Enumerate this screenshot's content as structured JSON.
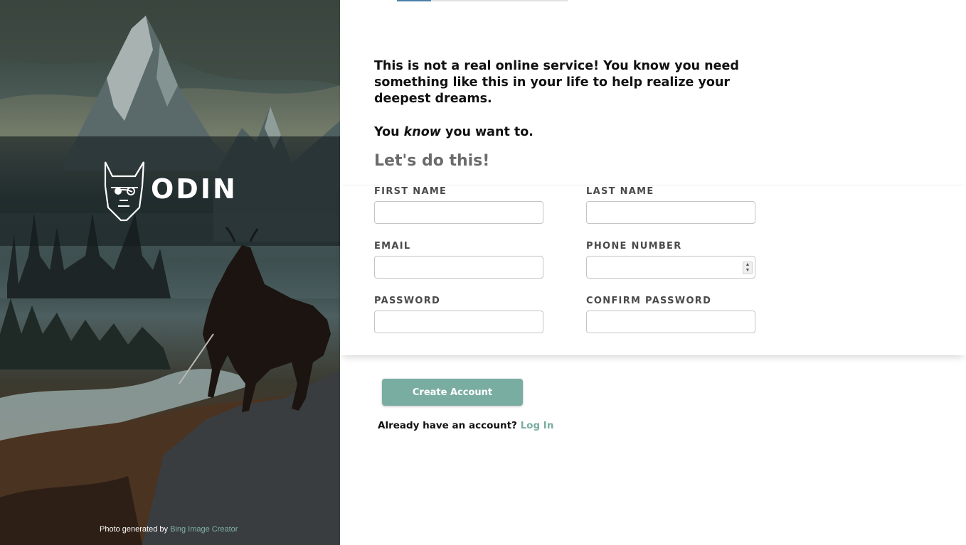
{
  "brand": {
    "name": "ODIN",
    "logo_icon": "viking-helmet-icon"
  },
  "hero": {
    "credit_prefix": "Photo generated by ",
    "credit_link": "Bing Image Creator"
  },
  "intro": {
    "line1": "This is not a real online service! You know you need something like this in your life to help realize your deepest dreams.",
    "line2_pre": "You ",
    "line2_em": "know",
    "line2_post": " you want to."
  },
  "form": {
    "heading": "Let's do this!",
    "fields": {
      "first_name": {
        "label": "FIRST NAME",
        "value": ""
      },
      "last_name": {
        "label": "LAST NAME",
        "value": ""
      },
      "email": {
        "label": "EMAIL",
        "value": ""
      },
      "phone": {
        "label": "PHONE NUMBER",
        "value": ""
      },
      "password": {
        "label": "PASSWORD",
        "value": ""
      },
      "confirm_password": {
        "label": "CONFIRM PASSWORD",
        "value": ""
      }
    },
    "submit_label": "Create Account"
  },
  "login": {
    "prompt": "Already have an account? ",
    "link": "Log In"
  },
  "colors": {
    "accent": "#7aada2",
    "heading_gray": "#6b6b6b",
    "label_gray": "#4a4a4a"
  }
}
